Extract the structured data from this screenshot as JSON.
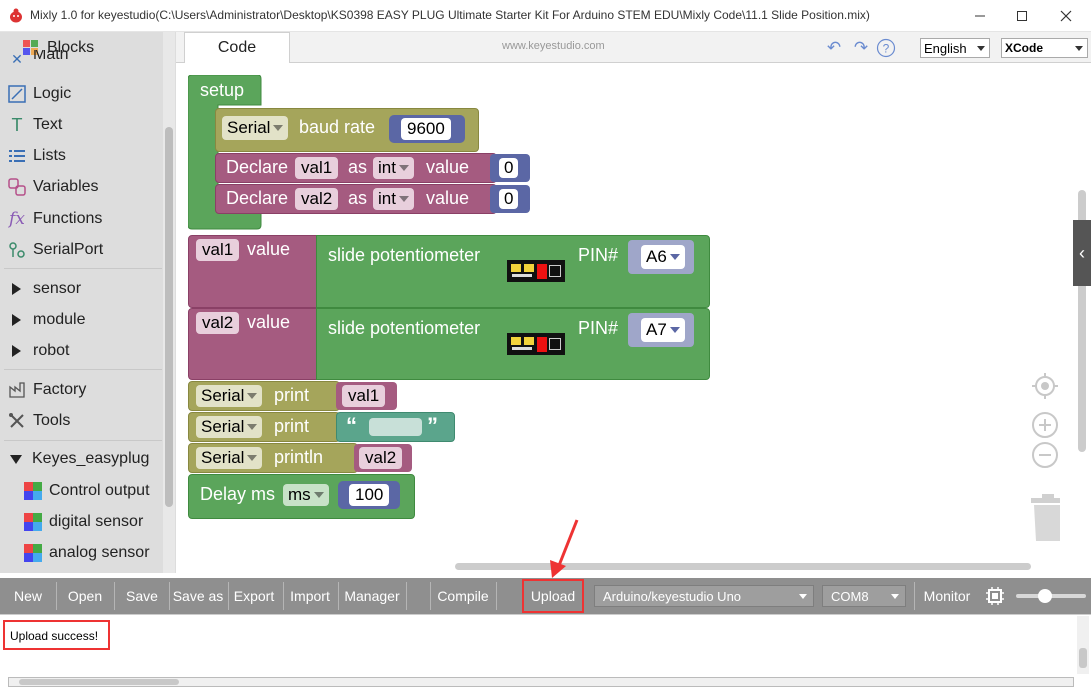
{
  "window": {
    "title": "Mixly 1.0 for keyestudio(C:\\Users\\Administrator\\Desktop\\KS0398 EASY PLUG Ultimate Starter Kit For Arduino STEM EDU\\Mixly Code\\11.1 Slide Position.mix)"
  },
  "sidebar": {
    "header": "Blocks",
    "partial_top": "Math",
    "categories": [
      "Logic",
      "Text",
      "Lists",
      "Variables",
      "Functions",
      "SerialPort"
    ],
    "groups": [
      "sensor",
      "module",
      "robot"
    ],
    "tools": [
      "Factory",
      "Tools"
    ],
    "expanded_group": "Keyes_easyplug",
    "sub_items": [
      "Control output",
      "digital sensor",
      "analog sensor"
    ]
  },
  "tabs": {
    "code": "Code"
  },
  "header": {
    "website": "www.keyestudio.com",
    "language": "English",
    "theme": "XCode"
  },
  "blocks": {
    "setup": "setup",
    "serial": "Serial",
    "baud_rate_label": "baud rate",
    "baud_rate": "9600",
    "declare": "Declare",
    "as": "as",
    "value": "value",
    "var1": "val1",
    "var2": "val2",
    "type": "int",
    "zero": "0",
    "slide_pot": "slide potentiometer",
    "pin_label": "PIN#",
    "pin1": "A6",
    "pin2": "A7",
    "print": "print",
    "println": "println",
    "quote_open": "“",
    "quote_close": "”",
    "delay": "Delay ms",
    "delay_unit": "ms",
    "delay_value": "100"
  },
  "toolbar": {
    "buttons": [
      "New",
      "Open",
      "Save",
      "Save as",
      "Export",
      "Import",
      "Manager",
      "Compile",
      "Upload"
    ],
    "board": "Arduino/keyestudio Uno",
    "port": "COM8",
    "monitor": "Monitor"
  },
  "output": {
    "message": "Upload success!"
  },
  "colors": {
    "setup_green": "#5ba55b",
    "serial_olive": "#a5a55b",
    "variable_pink": "#a55b80",
    "math_blue": "#5b67a5",
    "text_teal": "#5ba58c",
    "highlight_red": "#e33333"
  }
}
